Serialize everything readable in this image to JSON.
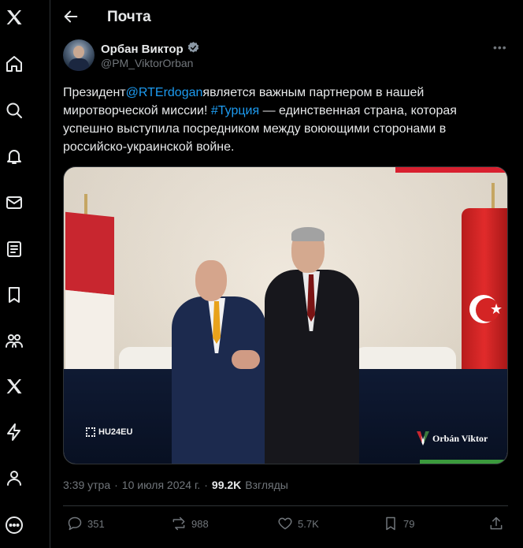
{
  "header": {
    "title": "Почта"
  },
  "nav": {
    "items": [
      "x-logo-icon",
      "home-icon",
      "search-icon",
      "notifications-icon",
      "messages-icon",
      "lists-icon",
      "bookmarks-icon",
      "communities-icon",
      "premium-x-icon",
      "verified-orgs-icon",
      "profile-icon",
      "more-icon"
    ]
  },
  "author": {
    "name": "Орбан Виктор",
    "handle": "@PM_ViktorOrban",
    "more": "•••"
  },
  "tweet": {
    "part1": "Президент",
    "mention": "@RTErdogan",
    "part2": "является важным партнером в нашей миротворческой миссии! ",
    "hashtag": "#Турция",
    "part3": " — единственная страна, которая успешно выступила посредником между воюющими сторонами в российско-украинской войне."
  },
  "photo": {
    "watermark_left": "HU24EU",
    "watermark_right": "Orbán Viktor",
    "colors": {
      "hu_red": "#c8262f",
      "hu_green": "#3b7a3d",
      "tr_red": "#e12b2b"
    }
  },
  "meta": {
    "time": "3:39 утра",
    "sep": "·",
    "date": "10 июля 2024 г.",
    "sep2": "·",
    "views_count": "99.2K",
    "views_label": "Взгляды"
  },
  "actions": {
    "replies": "351",
    "reposts": "988",
    "likes": "5.7K",
    "bookmarks": "79"
  },
  "colors": {
    "accent": "#1d9bf0",
    "muted": "#71767b",
    "background": "#000000"
  }
}
